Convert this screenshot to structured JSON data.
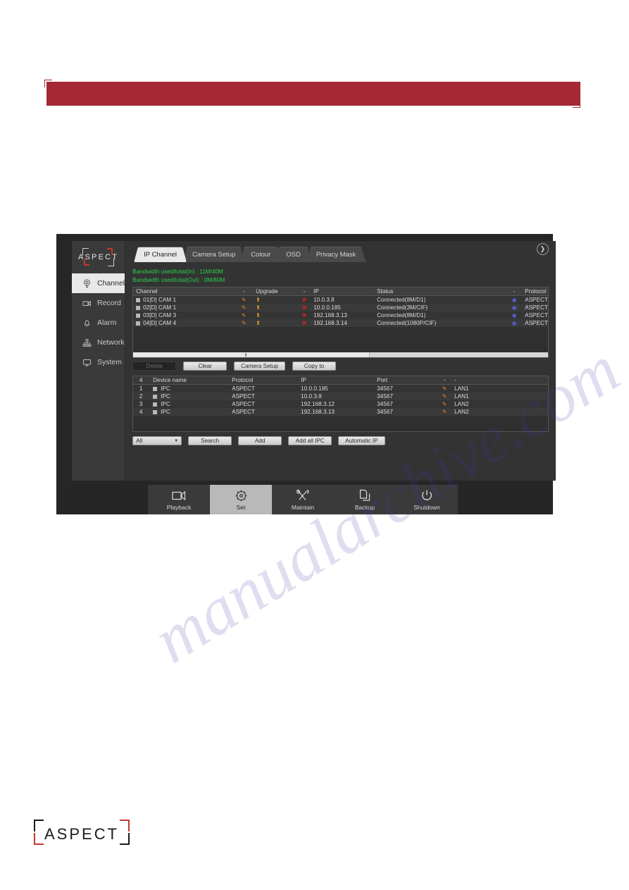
{
  "banner": {
    "accent_color": "#a52834",
    "text": ""
  },
  "window": {
    "brand": "ASPECT",
    "sidebar": [
      {
        "label": "Channel",
        "icon": "camera-dome-icon",
        "active": true
      },
      {
        "label": "Record",
        "icon": "video-camera-icon",
        "active": false
      },
      {
        "label": "Alarm",
        "icon": "bell-icon",
        "active": false
      },
      {
        "label": "Network",
        "icon": "network-tree-icon",
        "active": false
      },
      {
        "label": "System",
        "icon": "monitor-icon",
        "active": false
      }
    ],
    "tabs": [
      {
        "label": "IP Channel",
        "active": true
      },
      {
        "label": "Camera Setup",
        "active": false
      },
      {
        "label": "Colour",
        "active": false
      },
      {
        "label": "OSD",
        "active": false
      },
      {
        "label": "Privacy Mask",
        "active": false
      }
    ],
    "next_tab_icon": "chevron-right-icon",
    "bandwidth": {
      "in": "Bandwidth used/total(In) : 11M/40M",
      "out": "Bandwidth used/total(Out) : 0M/80M",
      "color": "#27d247"
    },
    "channel_table": {
      "headers": [
        "Channel",
        "-",
        "Upgrade",
        "-",
        "IP",
        "Status",
        "-",
        "Protocol"
      ],
      "rows": [
        {
          "channel": "01[D] CAM 1",
          "edit": "pencil-icon",
          "upgrade": "upload-icon",
          "del": "x-icon",
          "ip": "10.0.3.8",
          "status": "Connected(8M/D1)",
          "cfg": "circle-icon",
          "protocol": "ASPECT"
        },
        {
          "channel": "02[D] CAM 1",
          "edit": "pencil-icon",
          "upgrade": "upload-icon",
          "del": "x-icon",
          "ip": "10.0.0.185",
          "status": "Connected(3M/CIF)",
          "cfg": "circle-icon",
          "protocol": "ASPECT"
        },
        {
          "channel": "03[D] CAM 3",
          "edit": "pencil-icon",
          "upgrade": "upload-icon",
          "del": "x-icon",
          "ip": "192.168.3.13",
          "status": "Connected(8M/D1)",
          "cfg": "circle-icon",
          "protocol": "ASPECT"
        },
        {
          "channel": "04[D] CAM 4",
          "edit": "pencil-icon",
          "upgrade": "upload-icon",
          "del": "x-icon",
          "ip": "192.168.3.14",
          "status": "Connected(1080P/CIF)",
          "cfg": "circle-icon",
          "protocol": "ASPECT"
        }
      ]
    },
    "action_buttons": [
      {
        "label": "Delete",
        "disabled": true
      },
      {
        "label": "Clear",
        "disabled": false
      },
      {
        "label": "Camera Setup",
        "disabled": false
      },
      {
        "label": "Copy to",
        "disabled": false
      }
    ],
    "device_table": {
      "headers": [
        "4",
        "Device name",
        "Protocol",
        "IP",
        "Port",
        "-",
        "-"
      ],
      "rows": [
        {
          "num": "1",
          "name": "IPC",
          "protocol": "ASPECT",
          "ip": "10.0.0.185",
          "port": "34567",
          "edit": "pencil-icon",
          "lan": "LAN1"
        },
        {
          "num": "2",
          "name": "IPC",
          "protocol": "ASPECT",
          "ip": "10.0.3.8",
          "port": "34567",
          "edit": "pencil-icon",
          "lan": "LAN1"
        },
        {
          "num": "3",
          "name": "IPC",
          "protocol": "ASPECT",
          "ip": "192.168.3.12",
          "port": "34567",
          "edit": "pencil-icon",
          "lan": "LAN2"
        },
        {
          "num": "4",
          "name": "IPC",
          "protocol": "ASPECT",
          "ip": "192.168.3.13",
          "port": "34567",
          "edit": "pencil-icon",
          "lan": "LAN2"
        }
      ]
    },
    "filter_select": {
      "value": "All",
      "caret": "chevron-down-icon"
    },
    "bottom_buttons": [
      {
        "label": "Search"
      },
      {
        "label": "Add"
      },
      {
        "label": "Add all IPC"
      },
      {
        "label": "Automatic IP"
      }
    ],
    "toolbar": [
      {
        "label": "Playback",
        "icon": "video-camera-icon",
        "active": false
      },
      {
        "label": "Set",
        "icon": "gear-icon",
        "active": true
      },
      {
        "label": "Maintain",
        "icon": "tools-icon",
        "active": false
      },
      {
        "label": "Backup",
        "icon": "copy-files-icon",
        "active": false
      },
      {
        "label": "Shutdown",
        "icon": "power-icon",
        "active": false
      }
    ]
  },
  "footer": {
    "logo_text": "ASPECT"
  },
  "watermark": {
    "text": "manualarchive.com"
  }
}
